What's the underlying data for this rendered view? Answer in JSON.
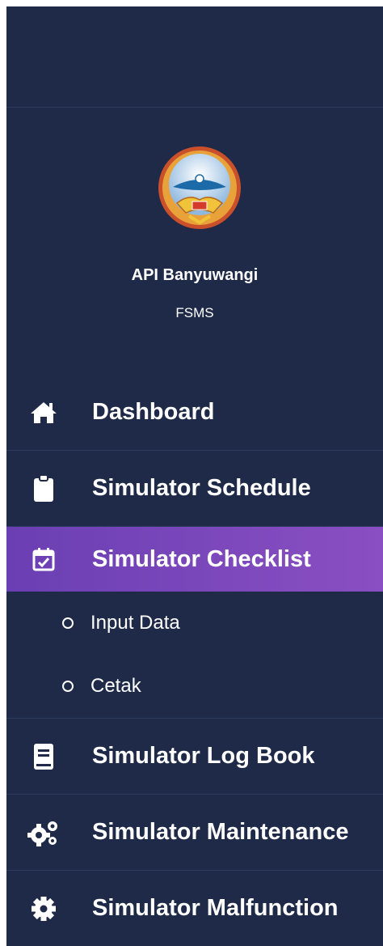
{
  "profile": {
    "org_name": "API Banyuwangi",
    "app_name": "FSMS"
  },
  "menu": {
    "dashboard": {
      "label": "Dashboard",
      "icon": "home-icon"
    },
    "schedule": {
      "label": "Simulator Schedule",
      "icon": "clipboard-icon"
    },
    "checklist": {
      "label": "Simulator Checklist",
      "icon": "calendar-check-icon"
    },
    "input_data": {
      "label": "Input Data",
      "icon": "circle-icon"
    },
    "cetak": {
      "label": "Cetak",
      "icon": "circle-icon"
    },
    "logbook": {
      "label": "Simulator Log Book",
      "icon": "book-icon"
    },
    "maintenance": {
      "label": "Simulator Maintenance",
      "icon": "cogs-icon"
    },
    "malfunction": {
      "label": "Simulator Malfunction",
      "icon": "gear-icon"
    }
  },
  "colors": {
    "sidebar_bg": "#1e2a47",
    "active_start": "#6a3fb3",
    "active_end": "#8a4fc2"
  }
}
